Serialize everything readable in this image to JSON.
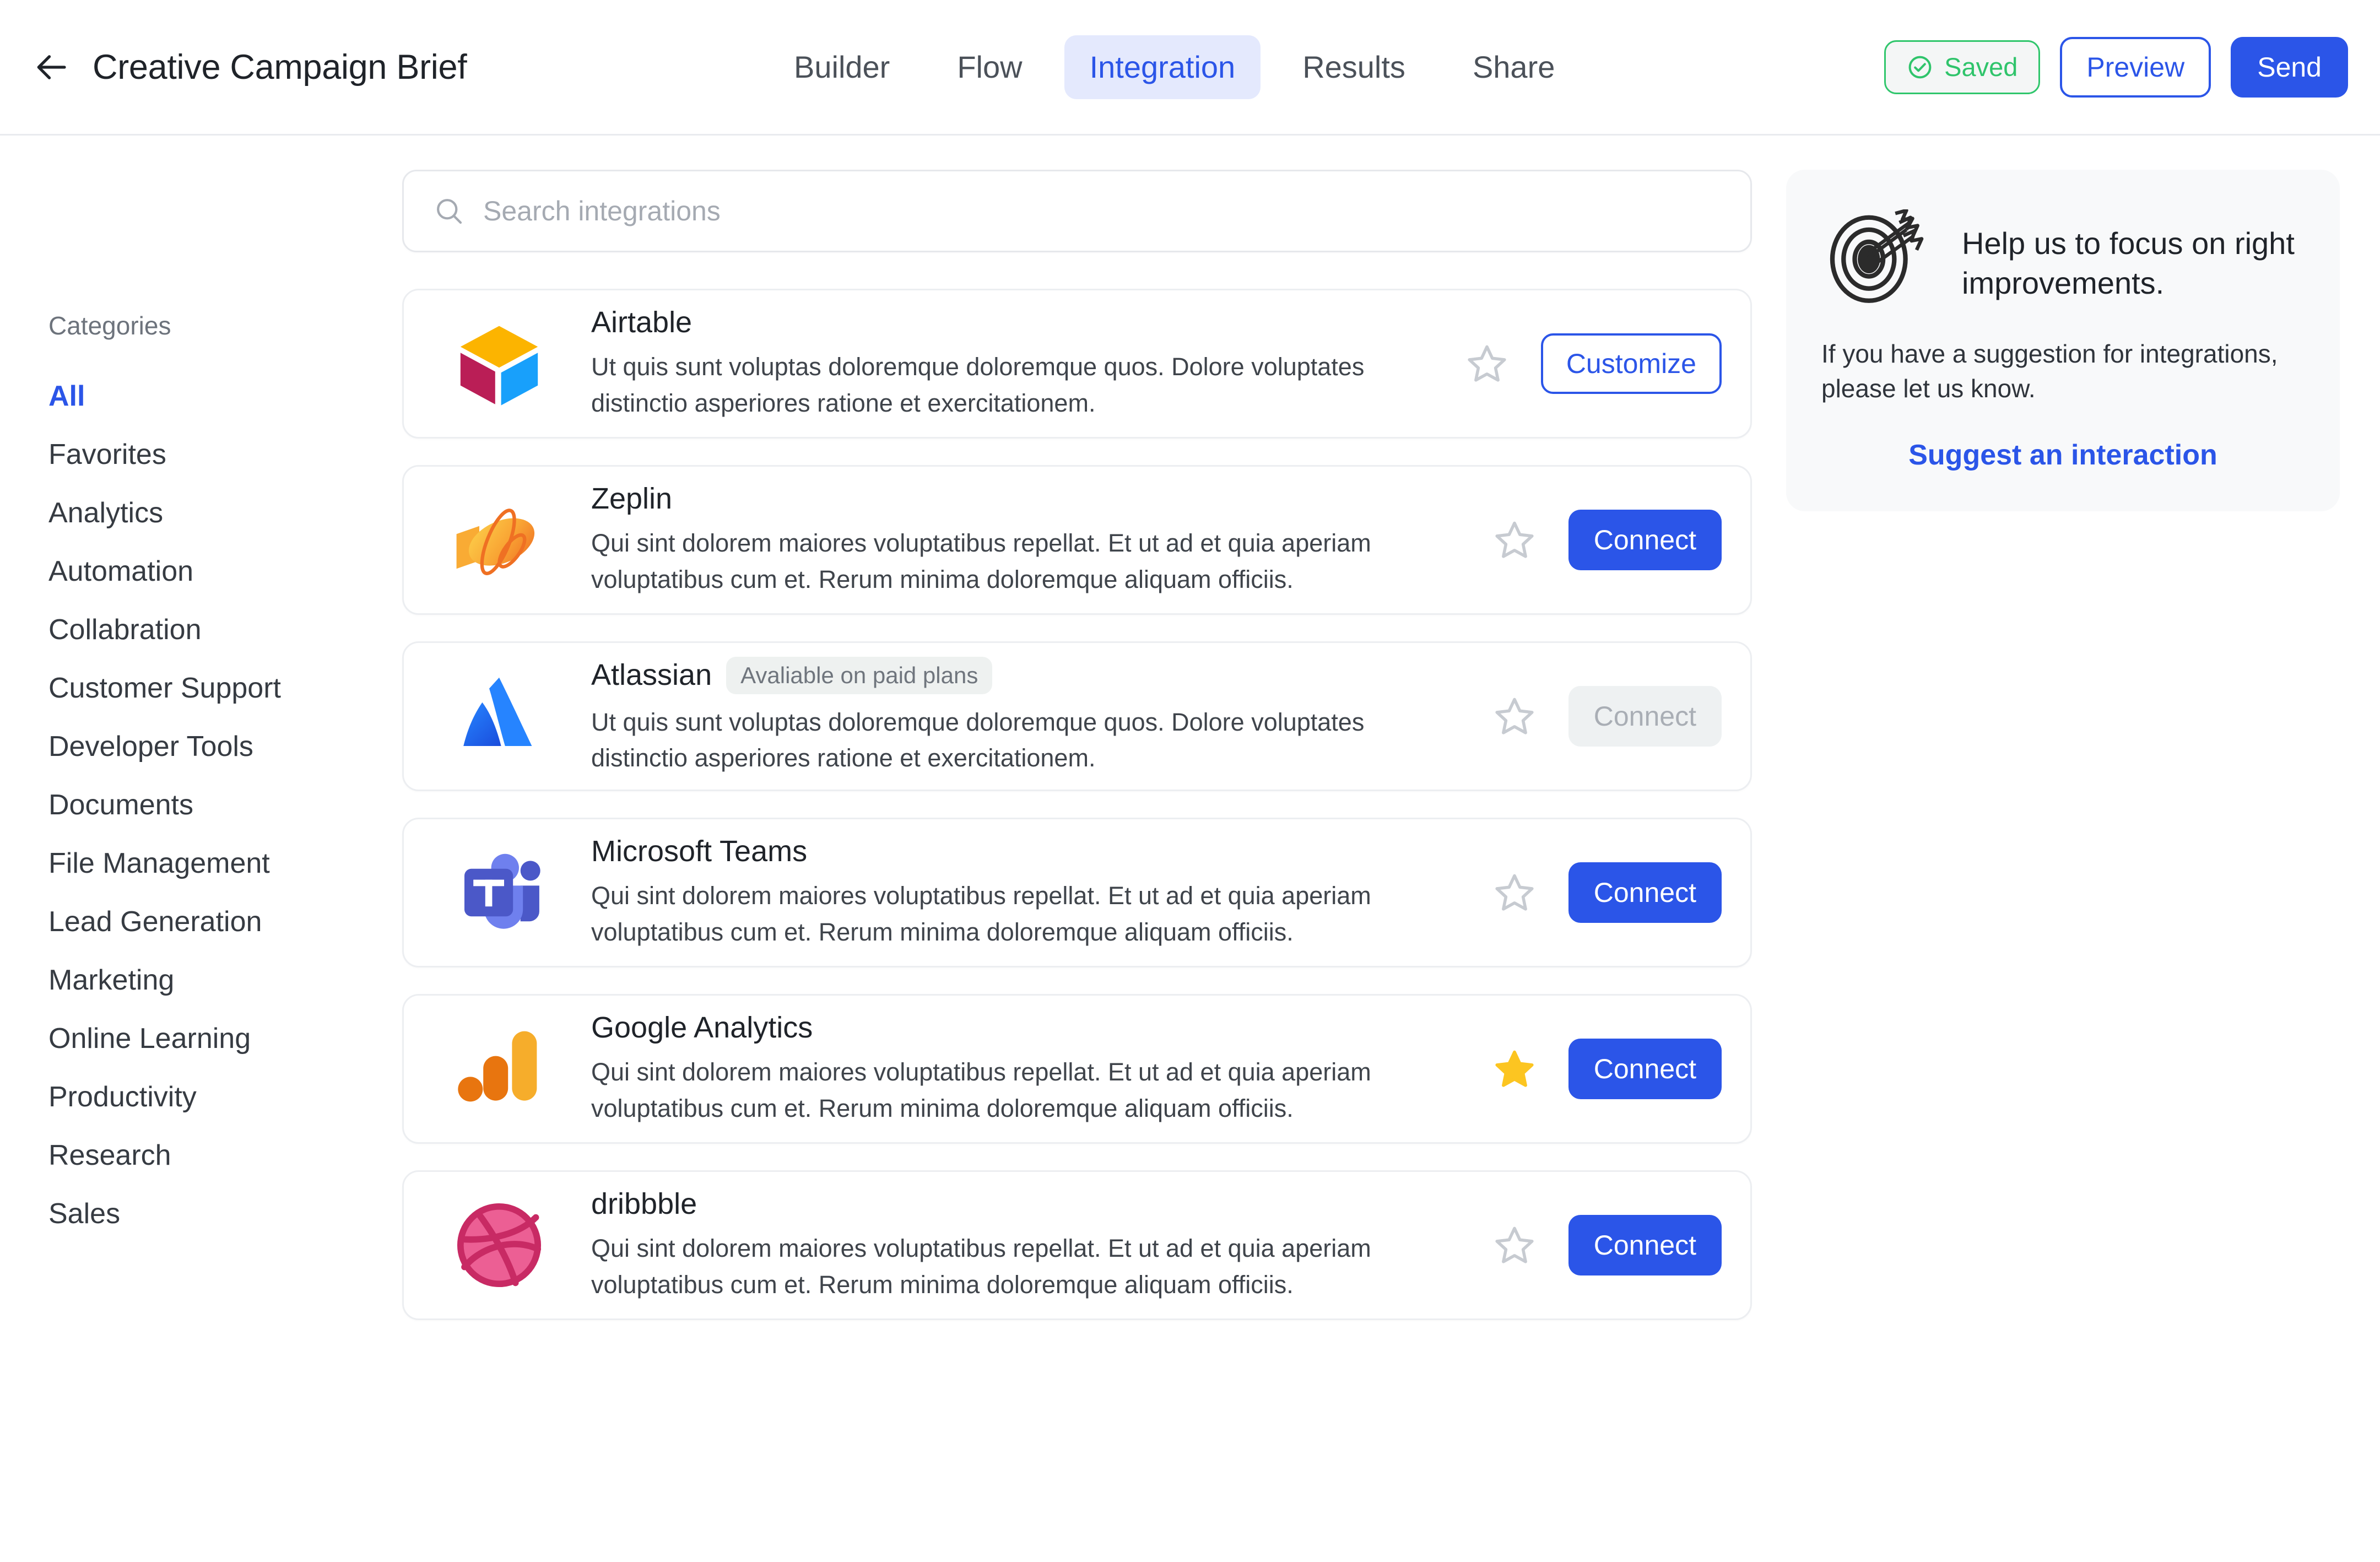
{
  "header": {
    "back_icon": "arrow-left-icon",
    "title": "Creative Campaign Brief",
    "tabs": [
      {
        "label": "Builder",
        "active": false
      },
      {
        "label": "Flow",
        "active": false
      },
      {
        "label": "Integration",
        "active": true
      },
      {
        "label": "Results",
        "active": false
      },
      {
        "label": "Share",
        "active": false
      }
    ],
    "saved_label": "Saved",
    "saved_icon": "check-circle-icon",
    "preview_label": "Preview",
    "send_label": "Send"
  },
  "sidebar": {
    "label": "Categories",
    "items": [
      {
        "label": "All",
        "active": true
      },
      {
        "label": "Favorites",
        "active": false
      },
      {
        "label": "Analytics",
        "active": false
      },
      {
        "label": "Automation",
        "active": false
      },
      {
        "label": "Collabration",
        "active": false
      },
      {
        "label": "Customer Support",
        "active": false
      },
      {
        "label": "Developer Tools",
        "active": false
      },
      {
        "label": "Documents",
        "active": false
      },
      {
        "label": "File Management",
        "active": false
      },
      {
        "label": "Lead Generation",
        "active": false
      },
      {
        "label": "Marketing",
        "active": false
      },
      {
        "label": "Online Learning",
        "active": false
      },
      {
        "label": "Productivity",
        "active": false
      },
      {
        "label": "Research",
        "active": false
      },
      {
        "label": "Sales",
        "active": false
      }
    ]
  },
  "search": {
    "placeholder": "Search integrations",
    "value": "",
    "icon": "search-icon"
  },
  "integrations": [
    {
      "name": "Airtable",
      "logo": "airtable-logo",
      "badge": null,
      "description": "Ut quis sunt voluptas doloremque doloremque quos. Dolore voluptates distinctio asperiores ratione et exercitationem.",
      "favorite": false,
      "action_label": "Customize",
      "action_style": "outline"
    },
    {
      "name": "Zeplin",
      "logo": "zeplin-logo",
      "badge": null,
      "description": "Qui sint dolorem maiores voluptatibus repellat. Et ut ad et quia aperiam voluptatibus cum et. Rerum minima doloremque aliquam officiis.",
      "favorite": false,
      "action_label": "Connect",
      "action_style": "primary"
    },
    {
      "name": "Atlassian",
      "logo": "atlassian-logo",
      "badge": "Avaliable on paid plans",
      "description": "Ut quis sunt voluptas doloremque doloremque quos. Dolore voluptates distinctio asperiores ratione et exercitationem.",
      "favorite": false,
      "action_label": "Connect",
      "action_style": "disabled"
    },
    {
      "name": "Microsoft Teams",
      "logo": "microsoft-teams-logo",
      "badge": null,
      "description": "Qui sint dolorem maiores voluptatibus repellat. Et ut ad et quia aperiam voluptatibus cum et. Rerum minima doloremque aliquam officiis.",
      "favorite": false,
      "action_label": "Connect",
      "action_style": "primary"
    },
    {
      "name": "Google Analytics",
      "logo": "google-analytics-logo",
      "badge": null,
      "description": "Qui sint dolorem maiores voluptatibus repellat. Et ut ad et quia aperiam voluptatibus cum et. Rerum minima doloremque aliquam officiis.",
      "favorite": true,
      "action_label": "Connect",
      "action_style": "primary"
    },
    {
      "name": "dribbble",
      "logo": "dribbble-logo",
      "badge": null,
      "description": "Qui sint dolorem maiores voluptatibus repellat. Et ut ad et quia aperiam voluptatibus cum et. Rerum minima doloremque aliquam officiis.",
      "favorite": false,
      "action_label": "Connect",
      "action_style": "primary"
    }
  ],
  "promo": {
    "icon": "target-with-arrows-icon",
    "title": "Help us to focus on right improvements.",
    "text": "If you have a suggestion for integrations, please let us know.",
    "link_label": "Suggest an interaction"
  },
  "colors": {
    "accent": "#2b55e8",
    "accent_soft": "#e4e9fd",
    "success": "#30c66c",
    "star_filled": "#fcc521",
    "star_empty": "#c7cbd1",
    "text_primary": "#1f2329",
    "text_muted": "#6d737c",
    "card_border": "#eceef1",
    "promo_bg": "#f8f9fa",
    "disabled_bg": "#eef1f2"
  }
}
